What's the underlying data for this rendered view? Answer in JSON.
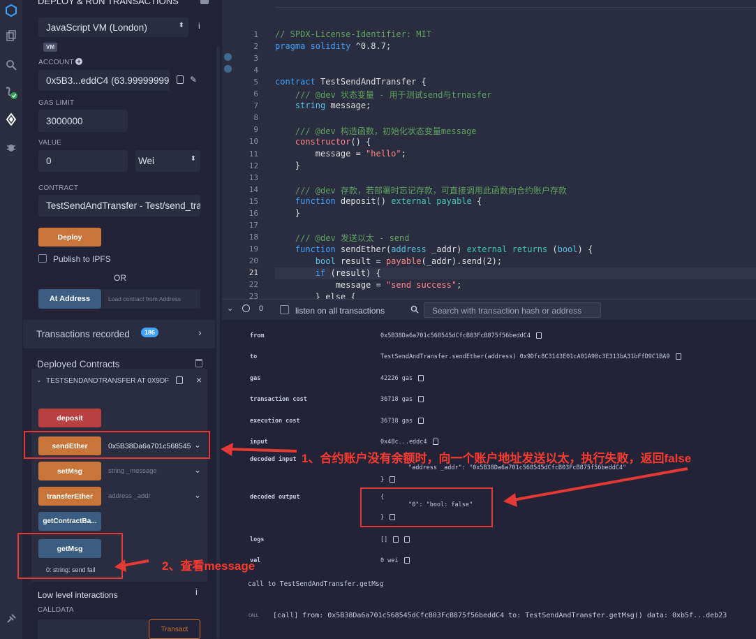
{
  "panel": {
    "title": "DEPLOY & RUN TRANSACTIONS",
    "environment": "JavaScript VM (London)",
    "vm_badge": "VM",
    "account_label": "ACCOUNT",
    "account_value": "0x5B3...eddC4 (63.99999999",
    "gas_limit_label": "GAS LIMIT",
    "gas_limit_value": "3000000",
    "value_label": "VALUE",
    "value_amount": "0",
    "value_unit": "Wei",
    "contract_label": "CONTRACT",
    "contract_value": "TestSendAndTransfer - Test/send_tra",
    "deploy_label": "Deploy",
    "publish_label": "Publish to IPFS",
    "or_label": "OR",
    "at_address_label": "At Address",
    "at_address_placeholder": "Load contract from Address",
    "transactions_recorded_label": "Transactions recorded",
    "transactions_recorded_count": "186",
    "deployed_contracts_label": "Deployed Contracts",
    "instance_title": "TESTSENDANDTRANSFER AT 0X9DF",
    "functions": [
      {
        "label": "deposit",
        "input": ""
      },
      {
        "label": "sendEther",
        "input": "0x5B38Da6a701c568545"
      },
      {
        "label": "setMsg",
        "input": "string _message"
      },
      {
        "label": "transferEther",
        "input": "address _addr"
      },
      {
        "label": "getContractBa...",
        "input": ""
      },
      {
        "label": "getMsg",
        "input": ""
      }
    ],
    "getmsg_result": "0: string: send fail",
    "low_level_label": "Low level interactions",
    "calldata_label": "CALLDATA",
    "transact_label": "Transact"
  },
  "editor": {
    "lines": [
      "1",
      "2",
      "3",
      "4",
      "5",
      "6",
      "7",
      "8",
      "9",
      "10",
      "11",
      "12",
      "13",
      "14",
      "15",
      "16",
      "17",
      "18",
      "19",
      "20",
      "21",
      "22",
      "23"
    ],
    "code": {
      "l1": "// SPDX-License-Identifier: MIT",
      "l2a": "pragma solidity",
      "l2b": " ^0.8.7;",
      "l5a": "contract",
      "l5b": " TestSendAndTransfer {",
      "l6": "    /// @dev 状态变量 - 用于测试send与trnasfer",
      "l7a": "    string",
      "l7b": " message;",
      "l9": "    /// @dev 构造函数，初始化状态变量message",
      "l10a": "    constructor",
      "l10b": "() {",
      "l11a": "        message = ",
      "l11b": "\"hello\"",
      "l11c": ";",
      "l12": "    }",
      "l14": "    /// @dev 存款，若部署时忘记存款，可直接调用此函数向合约账户存款",
      "l15a": "    function",
      "l15b": " deposit() ",
      "l15c": "external payable",
      "l15d": " {",
      "l16": "    }",
      "l18": "    /// @dev 发送以太 - send",
      "l19a": "    function",
      "l19b": " sendEther(",
      "l19c": "address",
      "l19d": " _addr) ",
      "l19e": "external returns",
      "l19f": " (",
      "l19g": "bool",
      "l19h": ") {",
      "l20a": "        bool",
      "l20b": " result = ",
      "l20c": "payable",
      "l20d": "(_addr).send(2);",
      "l21a": "        if",
      "l21b": " (result) {",
      "l22a": "            message = ",
      "l22b": "\"send success\"",
      "l22c": ";",
      "l23": "        } else {"
    }
  },
  "terminal": {
    "count": "0",
    "listen_label": "listen on all transactions",
    "search_placeholder": "Search with transaction hash or address",
    "rows": {
      "from_k": "from",
      "from_v": "0x5B38Da6a701c568545dCfcB03FcB875f56beddC4",
      "to_k": "to",
      "to_v": "TestSendAndTransfer.sendEther(address) 0x9Dfc8C3143E01cA01A90c3E313bA31bFfD9C1BA9",
      "gas_k": "gas",
      "gas_v": "42226 gas",
      "tc_k": "transaction cost",
      "tc_v": "36718 gas",
      "ec_k": "execution cost",
      "ec_v": "36718 gas",
      "input_k": "input",
      "input_v": "0x48c...eddc4",
      "di_k": "decoded input",
      "di_v": "\"address _addr\": \"0x5B38Da6a701c568545dCfcB03FcB875f56beddC4\"",
      "di_close": "}",
      "do_k": "decoded output",
      "do_open": "{",
      "do_v": "\"0\": \"bool: false\"",
      "do_close": "}",
      "logs_k": "logs",
      "logs_v": "[]",
      "val_k": "val",
      "val_v": "0 wei"
    },
    "call_line": "call to TestSendAndTransfer.getMsg",
    "call_tag": "CALL",
    "call_detail": "[call] from: 0x5B38Da6a701c568545dCfcB03FcB875f56beddC4 to: TestSendAndTransfer.getMsg() data: 0xb5f...deb23"
  },
  "annotations": {
    "a1": "1、合约账户没有余额时，向一个账户地址发送以太，执行失败，返回false",
    "a2": "2、查看message"
  }
}
